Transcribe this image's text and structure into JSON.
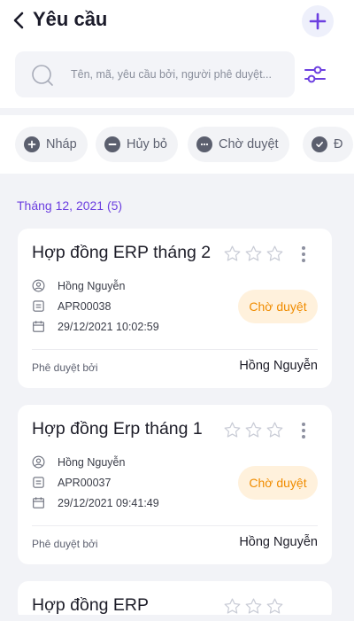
{
  "header": {
    "title": "Yêu cầu",
    "back_icon": "chevron-left-icon",
    "add_icon": "plus-icon"
  },
  "search": {
    "placeholder": "Tên, mã, yêu cầu bởi, người phê duyệt...",
    "value": "",
    "filter_icon": "sliders-icon"
  },
  "filters": [
    {
      "label": "Nháp",
      "icon": "plus-circle-icon"
    },
    {
      "label": "Hủy bỏ",
      "icon": "minus-circle-icon"
    },
    {
      "label": "Chờ duyệt",
      "icon": "more-circle-icon"
    },
    {
      "label": "Đ",
      "icon": "check-circle-icon"
    }
  ],
  "section": {
    "title": "Tháng 12, 2021 (5)"
  },
  "requests": [
    {
      "title": "Hợp đồng ERP tháng 2",
      "requester": "Hồng Nguyễn",
      "code": "APR00038",
      "datetime": "29/12/2021 10:02:59",
      "status": "Chờ duyệt",
      "approved_by_label": "Phê duyệt bởi",
      "approver": "Hồng Nguyễn",
      "rating": 0
    },
    {
      "title": "Hợp đồng Erp tháng 1",
      "requester": "Hồng Nguyễn",
      "code": "APR00037",
      "datetime": "29/12/2021 09:41:49",
      "status": "Chờ duyệt",
      "approved_by_label": "Phê duyệt bởi",
      "approver": "Hồng Nguyễn",
      "rating": 0
    },
    {
      "title": "Hợp đồng ERP",
      "rating": 0
    }
  ],
  "colors": {
    "accent": "#6c3fe0",
    "status_bg": "#fff1dc",
    "status_text": "#f08c00",
    "page_bg": "#f2f3f7"
  }
}
